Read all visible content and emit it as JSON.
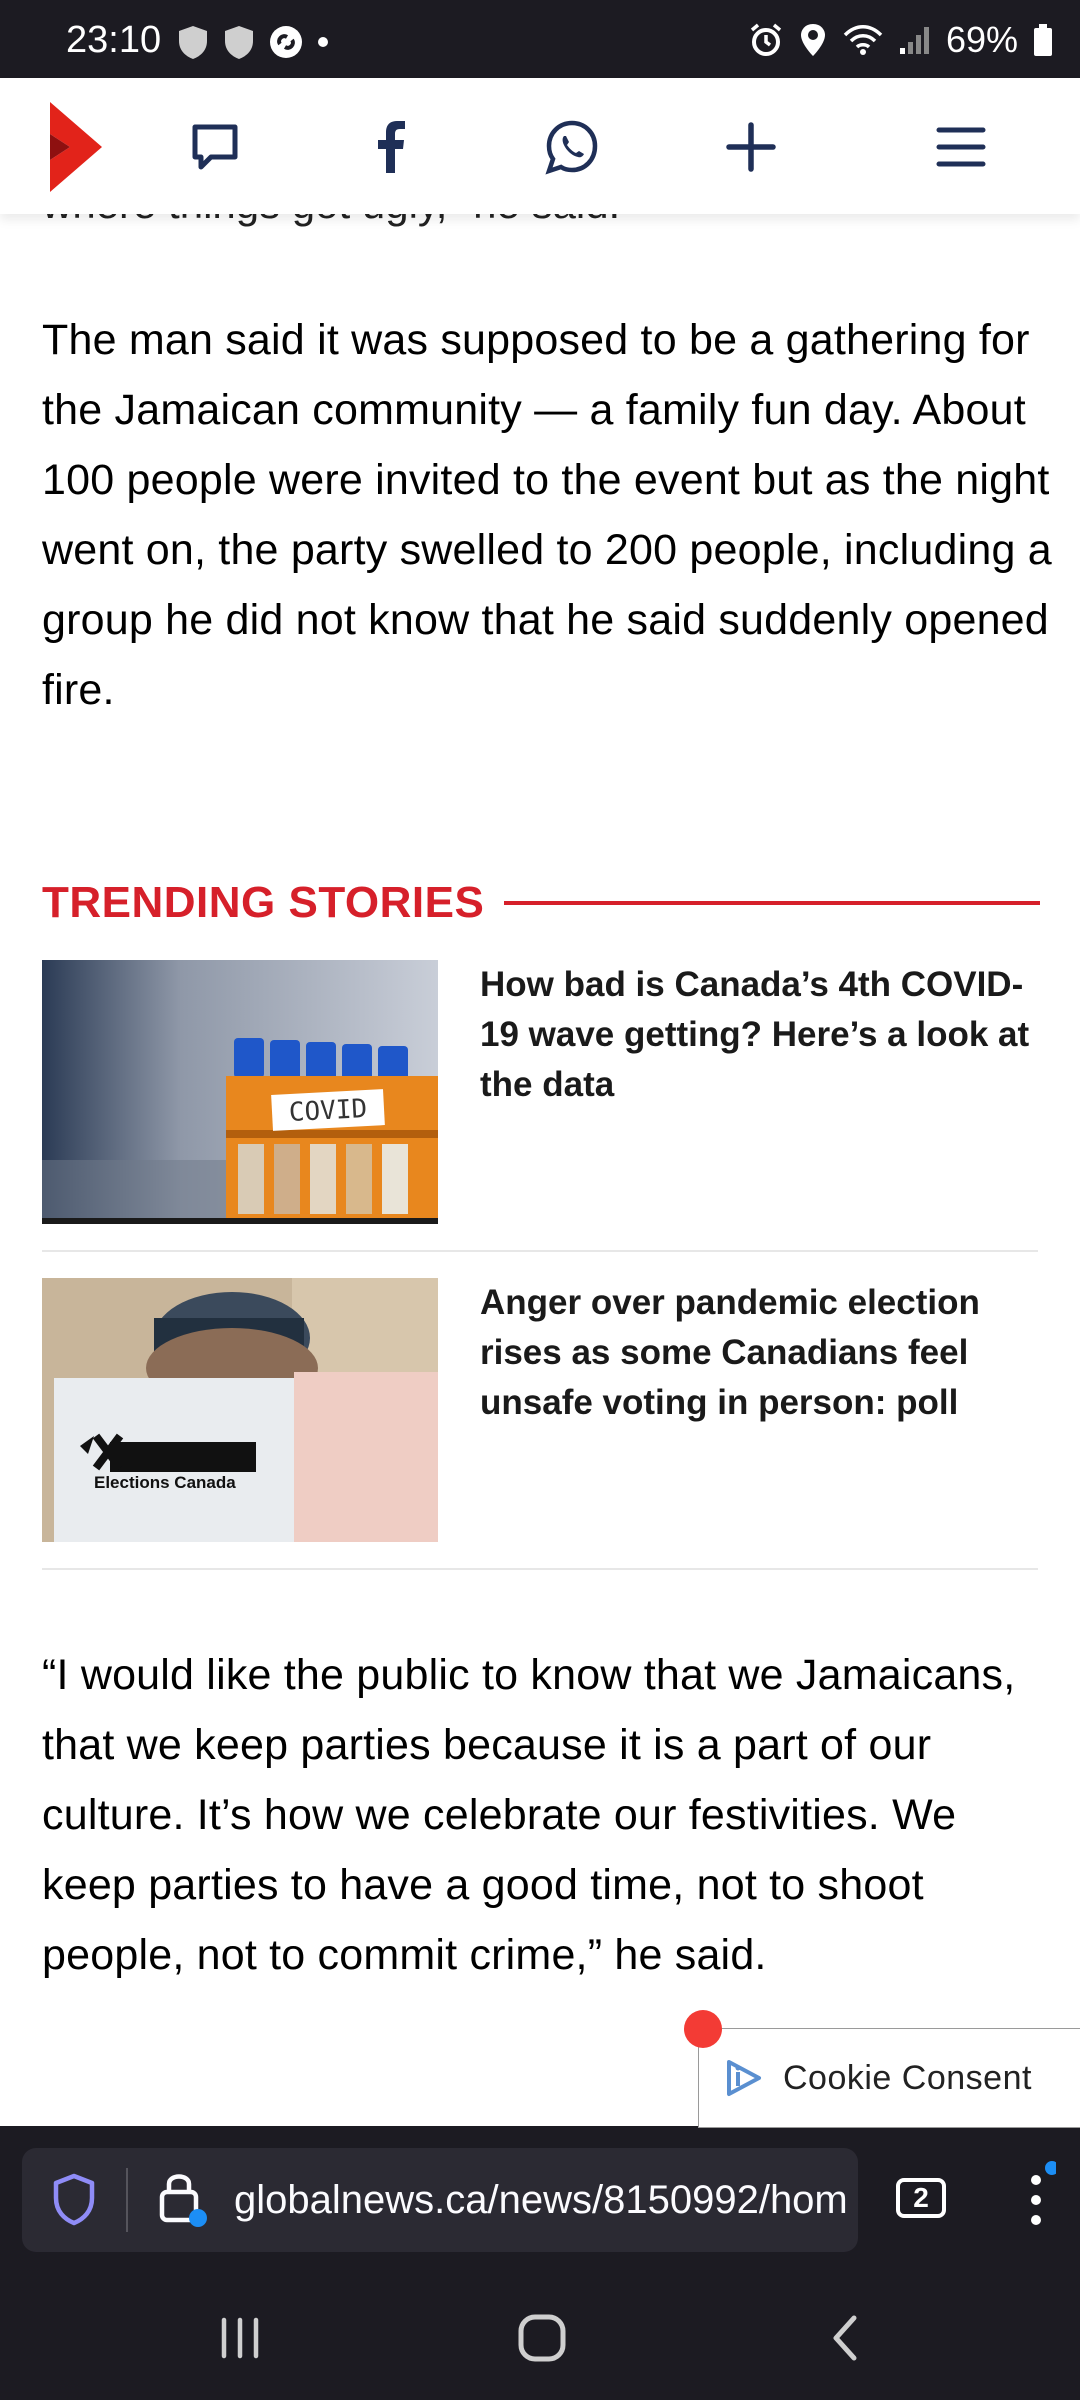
{
  "status_bar": {
    "time": "23:10",
    "battery": "69%"
  },
  "site_nav": {
    "icons": [
      "logo-icon",
      "comment-icon",
      "facebook-icon",
      "whatsapp-icon",
      "plus-icon",
      "menu-icon"
    ]
  },
  "article": {
    "clipped_line": "where things got ugly,” he said.",
    "paragraph1": "The man said it was supposed to be a gathering for the Jamaican community — a family fun day. About 100 people were invited to the event but as the night went on, the party swelled to 200 people, including a group he did not know that he said suddenly opened fire.",
    "paragraph2": "“I would like the public to know that we Jamaicans, that we keep parties because it is a part of our culture. It’s how we celebrate our festivities. We keep parties to have a good time, not to shoot people, not to commit crime,” he said."
  },
  "trending": {
    "title": "TRENDING STORIES",
    "stories": [
      {
        "title": "How bad is Canada’s 4th COVID-19 wave getting? Here’s a look at the data",
        "thumb_text": "COVID"
      },
      {
        "title": "Anger over pandemic election rises as some Canadians feel unsafe voting in person: poll",
        "thumb_text": "Elections Canada"
      }
    ]
  },
  "cookie": {
    "label": "Cookie Consent"
  },
  "browser": {
    "url": "globalnews.ca/news/8150992/hom",
    "tab_count": "2"
  },
  "colors": {
    "accent": "#d6202a",
    "nav_icon": "#1f2f57",
    "bar_bg": "#1c1b22"
  }
}
